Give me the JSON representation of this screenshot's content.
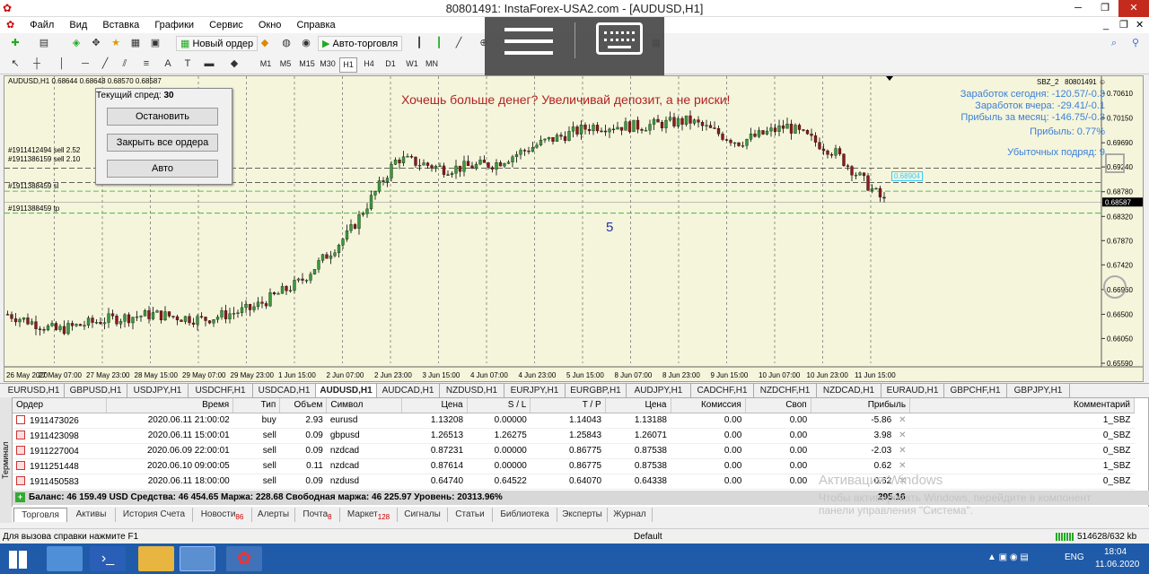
{
  "window": {
    "title": "80801491: InstaForex-USA2.com - [AUDUSD,H1]"
  },
  "menu": [
    "Файл",
    "Вид",
    "Вставка",
    "Графики",
    "Сервис",
    "Окно",
    "Справка"
  ],
  "toolbar": {
    "new_order": "Новый ордер",
    "autotrading": "Авто-торговля"
  },
  "timeframes": [
    "M1",
    "M5",
    "M15",
    "M30",
    "H1",
    "H4",
    "D1",
    "W1",
    "MN"
  ],
  "chart": {
    "header": "AUDUSD,H1  0.68644 0.68648 0.68570 0.68587",
    "spread_label": "Текущий спред:",
    "spread_value": "30",
    "btn_stop": "Остановить",
    "btn_close_all": "Закрыть все ордера",
    "btn_auto": "Авто",
    "slogan": "Хочешь больше денег? Увеличивай депозит, а не риски!",
    "ea_label": "SBZ_2",
    "account": "80801491",
    "stats": [
      "Заработок сегодня: -120.57/-0.3",
      "Заработок вчера: -29.41/-0.1",
      "Прибыль за месяц: -146.75/-0.3",
      "Прибыль: 0.77%",
      "Убыточных подряд: 9"
    ],
    "order_labels": [
      "#1911412494 sell 2.52",
      "#1911386159 sell 2.10",
      "#1911388459 sl",
      "#1911388459 tp"
    ],
    "marker": "5",
    "bid_tag": "0.68587",
    "price_label_box": "0.68904",
    "prices": [
      "0.70610",
      "0.70150",
      "0.69690",
      "0.69240",
      "0.68780",
      "0.68320",
      "0.67870",
      "0.67420",
      "0.66960",
      "0.66500",
      "0.66050",
      "0.65590"
    ],
    "times": [
      "26 May 2020",
      "27 May 07:00",
      "27 May 23:00",
      "28 May 15:00",
      "29 May 07:00",
      "29 May 23:00",
      "1 Jun 15:00",
      "2 Jun 07:00",
      "2 Jun 23:00",
      "3 Jun 15:00",
      "4 Jun 07:00",
      "4 Jun 23:00",
      "5 Jun 15:00",
      "8 Jun 07:00",
      "8 Jun 23:00",
      "9 Jun 15:00",
      "10 Jun 07:00",
      "10 Jun 23:00",
      "11 Jun 15:00"
    ]
  },
  "chart_data": {
    "type": "line",
    "title": "AUDUSD,H1",
    "ylim": [
      0.6559,
      0.7061
    ],
    "x": [
      "26 May 2020",
      "27 May 07:00",
      "27 May 23:00",
      "28 May 15:00",
      "29 May 07:00",
      "29 May 23:00",
      "1 Jun 15:00",
      "2 Jun 07:00",
      "2 Jun 23:00",
      "3 Jun 15:00",
      "4 Jun 07:00",
      "4 Jun 23:00",
      "5 Jun 15:00",
      "8 Jun 07:00",
      "8 Jun 23:00",
      "9 Jun 15:00",
      "10 Jun 07:00",
      "10 Jun 23:00",
      "11 Jun 15:00"
    ],
    "series": [
      {
        "values": [
          0.665,
          0.662,
          0.664,
          0.665,
          0.664,
          0.666,
          0.671,
          0.68,
          0.694,
          0.692,
          0.693,
          0.697,
          0.7,
          0.7,
          0.701,
          0.697,
          0.7,
          0.695,
          0.686
        ]
      }
    ]
  },
  "symbol_tabs": [
    "EURUSD,H1",
    "GBPUSD,H1",
    "USDJPY,H1",
    "USDCHF,H1",
    "USDCAD,H1",
    "AUDUSD,H1",
    "AUDCAD,H1",
    "NZDUSD,H1",
    "EURJPY,H1",
    "EURGBP,H1",
    "AUDJPY,H1",
    "CADCHF,H1",
    "NZDCHF,H1",
    "NZDCAD,H1",
    "EURAUD,H1",
    "GBPCHF,H1",
    "GBPJPY,H1"
  ],
  "active_symbol_tab": "AUDUSD,H1",
  "terminal": {
    "side_label": "Терминал",
    "columns": [
      "Ордер",
      "Время",
      "Тип",
      "Объем",
      "Символ",
      "Цена",
      "S / L",
      "T / P",
      "Цена",
      "Комиссия",
      "Своп",
      "Прибыль",
      "Комментарий"
    ],
    "rows": [
      [
        "1911473026",
        "2020.06.11 21:00:02",
        "buy",
        "2.93",
        "eurusd",
        "1.13208",
        "0.00000",
        "1.14043",
        "1.13188",
        "0.00",
        "0.00",
        "-5.86",
        "1_SBZ"
      ],
      [
        "1911423098",
        "2020.06.11 15:00:01",
        "sell",
        "0.09",
        "gbpusd",
        "1.26513",
        "1.26275",
        "1.25843",
        "1.26071",
        "0.00",
        "0.00",
        "3.98",
        "0_SBZ"
      ],
      [
        "1911227004",
        "2020.06.09 22:00:01",
        "sell",
        "0.09",
        "nzdcad",
        "0.87231",
        "0.00000",
        "0.86775",
        "0.87538",
        "0.00",
        "0.00",
        "-2.03",
        "0_SBZ"
      ],
      [
        "1911251448",
        "2020.06.10 09:00:05",
        "sell",
        "0.11",
        "nzdcad",
        "0.87614",
        "0.00000",
        "0.86775",
        "0.87538",
        "0.00",
        "0.00",
        "0.62",
        "1_SBZ"
      ],
      [
        "1911450583",
        "2020.06.11 18:00:00",
        "sell",
        "0.09",
        "nzdusd",
        "0.64740",
        "0.64522",
        "0.64070",
        "0.64338",
        "0.00",
        "0.00",
        "0.62",
        "0_SBZ"
      ]
    ],
    "balance": "Баланс: 46 159.49 USD  Средства: 46 454.65  Маржа: 228.68  Свободная маржа: 46 225.97  Уровень: 20313.96%",
    "total_profit": "295.16",
    "tabs": [
      {
        "label": "Торговля",
        "badge": ""
      },
      {
        "label": "Активы",
        "badge": ""
      },
      {
        "label": "История Счета",
        "badge": ""
      },
      {
        "label": "Новости",
        "badge": "86"
      },
      {
        "label": "Алерты",
        "badge": ""
      },
      {
        "label": "Почта",
        "badge": "8"
      },
      {
        "label": "Маркет",
        "badge": "128"
      },
      {
        "label": "Сигналы",
        "badge": ""
      },
      {
        "label": "Статьи",
        "badge": ""
      },
      {
        "label": "Библиотека",
        "badge": ""
      },
      {
        "label": "Эксперты",
        "badge": ""
      },
      {
        "label": "Журнал",
        "badge": ""
      }
    ]
  },
  "status": {
    "help": "Для вызова справки нажмите F1",
    "profile": "Default",
    "traffic": "514628/632 kb"
  },
  "watermark": {
    "line1": "Активация Windows",
    "line2": "Чтобы активировать Windows, перейдите в компонент",
    "line3": "панели управления \"Система\"."
  },
  "taskbar": {
    "lang": "ENG",
    "time": "18:04",
    "date": "11.06.2020"
  }
}
